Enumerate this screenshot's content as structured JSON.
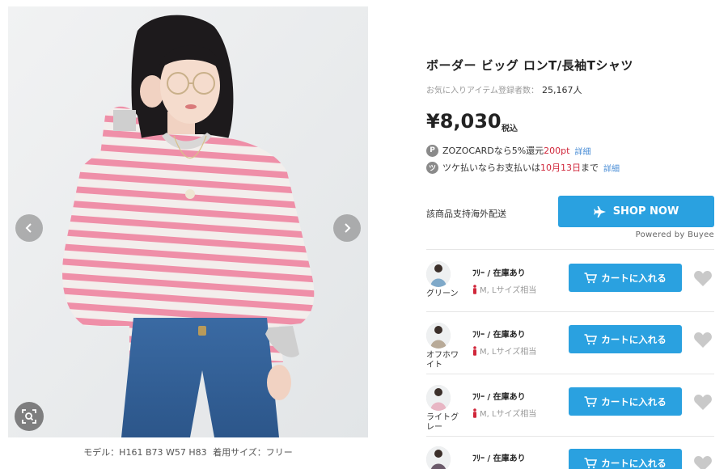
{
  "gallery": {
    "prev_icon": "chevron-left-icon",
    "next_icon": "chevron-right-icon",
    "zoom_icon": "zoom-scan-icon",
    "model_label": "モデル：H161 B73 W57 H83",
    "size_label": "着用サイズ：フリー"
  },
  "product": {
    "title": "ボーダー ビッグ ロンT/長袖Tシャツ",
    "fav_label": "お気に入りアイテム登録者数：",
    "fav_count": "25,167人",
    "price": "¥8,030",
    "tax_label": "税込"
  },
  "promos": [
    {
      "icon": "P",
      "text_a": "ZOZOCARDなら",
      "em_a": "5%",
      "text_b": "還元",
      "em_b": "200pt",
      "link": "詳細"
    },
    {
      "icon": "ツ",
      "text_a": "ツケ払いならお支払いは",
      "em_a": "10月13日",
      "text_b": "まで",
      "link": "詳細"
    }
  ],
  "shipping": {
    "label": "該商品支持海外配送",
    "button_label": "SHOP NOW",
    "button_icon": "airplane-icon",
    "powered_by": "Powered by Buyee"
  },
  "variants": [
    {
      "color_name": "グリーン",
      "stock": "ﾌﾘｰ / 在庫あり",
      "size_note": "M, Lサイズ相当",
      "cart_label": "カートに入れる",
      "thumb_color": "#7fa9c9"
    },
    {
      "color_name": "オフホワイト",
      "stock": "ﾌﾘｰ / 在庫あり",
      "size_note": "M, Lサイズ相当",
      "cart_label": "カートに入れる",
      "thumb_color": "#b8aa98"
    },
    {
      "color_name": "ライトグレー",
      "stock": "ﾌﾘｰ / 在庫あり",
      "size_note": "M, Lサイズ相当",
      "cart_label": "カートに入れる",
      "thumb_color": "#e8b6c4"
    },
    {
      "color_name": "",
      "stock": "ﾌﾘｰ / 在庫あり",
      "size_note": "",
      "cart_label": "カートに入れる",
      "thumb_color": "#6a5a6a"
    }
  ],
  "colors": {
    "accent": "#2aa1e0",
    "highlight_red": "#d0263a",
    "link_blue": "#4a8ed6",
    "stripe_pink": "#ef8fa8"
  }
}
